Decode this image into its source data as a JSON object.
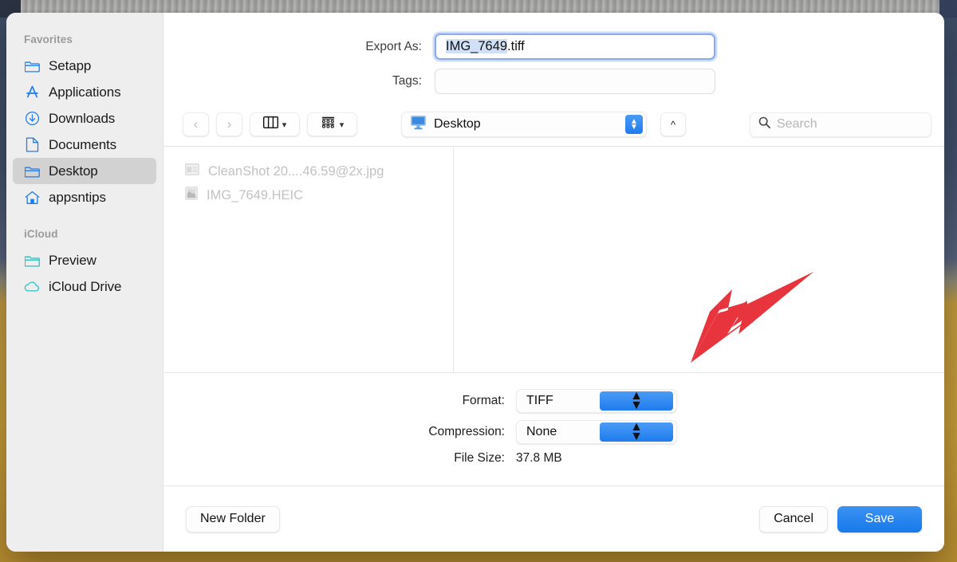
{
  "dialog": {
    "title": "Export",
    "accent_color": "#1f7ced",
    "arrow_color": "#e8343c"
  },
  "form": {
    "export_as_label": "Export As:",
    "filename_selected": "IMG_7649",
    "filename_extension": ".tiff",
    "filename_full": "IMG_7649.tiff",
    "tags_label": "Tags:",
    "tags_value": ""
  },
  "toolbar": {
    "back_icon": "chevron-left-icon",
    "forward_icon": "chevron-right-icon",
    "view_mode": "column-view",
    "group_mode": "group-by-icon",
    "path_label": "Desktop",
    "path_icon": "imac-display-icon",
    "up_icon": "chevron-up-icon",
    "search_placeholder": "Search",
    "search_value": ""
  },
  "files": [
    {
      "name": "CleanShot 20....46.59@2x.jpg",
      "icon": "image-file-icon"
    },
    {
      "name": "IMG_7649.HEIC",
      "icon": "photo-file-icon"
    }
  ],
  "options": {
    "format_label": "Format:",
    "format_value": "TIFF",
    "compression_label": "Compression:",
    "compression_value": "None",
    "filesize_label": "File Size:",
    "filesize_value": "37.8 MB"
  },
  "footer": {
    "new_folder_label": "New Folder",
    "cancel_label": "Cancel",
    "save_label": "Save"
  },
  "sidebar": {
    "favorites_header": "Favorites",
    "icloud_header": "iCloud",
    "favorites": [
      {
        "label": "Setapp",
        "icon": "folder-icon",
        "selected": false
      },
      {
        "label": "Applications",
        "icon": "app-store-icon",
        "selected": false
      },
      {
        "label": "Downloads",
        "icon": "downloads-icon",
        "selected": false
      },
      {
        "label": "Documents",
        "icon": "document-icon",
        "selected": false
      },
      {
        "label": "Desktop",
        "icon": "folder-icon",
        "selected": true
      },
      {
        "label": "appsntips",
        "icon": "home-icon",
        "selected": false
      }
    ],
    "icloud": [
      {
        "label": "Preview",
        "icon": "folder-icon",
        "selected": false
      },
      {
        "label": "iCloud Drive",
        "icon": "cloud-icon",
        "selected": false
      }
    ]
  }
}
